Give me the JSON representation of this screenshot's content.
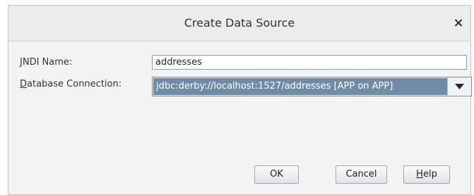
{
  "dialog": {
    "title": "Create Data Source",
    "close_label": "×"
  },
  "form": {
    "jndi_label_mnemonic": "J",
    "jndi_label_rest": "NDI Name:",
    "jndi_value": "addresses",
    "db_label_mnemonic": "D",
    "db_label_rest": "atabase Connection:",
    "db_value": "jdbc:derby://localhost:1527/addresses [APP on APP]"
  },
  "buttons": {
    "ok_label": "OK",
    "cancel_label": "Cancel",
    "help_mnemonic": "H",
    "help_rest": "elp"
  },
  "icons": {
    "close": "close-icon",
    "dropdown": "chevron-down-icon"
  }
}
